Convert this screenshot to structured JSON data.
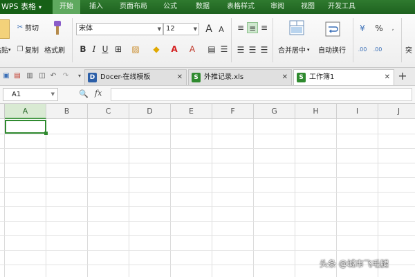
{
  "app": {
    "brand": "WPS 表格",
    "brand_caret": "▾"
  },
  "menu": {
    "items": [
      "开始",
      "插入",
      "页面布局",
      "公式",
      "数据",
      "表格样式",
      "审阅",
      "视图",
      "开发工具"
    ],
    "active_index": 0
  },
  "ribbon": {
    "paste_label": "粘贴",
    "cut_label": "剪切",
    "copy_label": "复制",
    "format_painter_label": "格式刷",
    "font_name": "宋体",
    "font_size": "12",
    "bold": "B",
    "italic": "I",
    "underline": "U",
    "grow_font": "A",
    "shrink_font": "A",
    "merge_center_label": "合并居中",
    "wrap_text_label": "自动换行",
    "percent": "%",
    "increase_decimal": ".00",
    "decrease_decimal": ".00",
    "right_cut_label": "突"
  },
  "tabs": [
    {
      "label": "Docer-在线模板",
      "icon": "D",
      "active": false
    },
    {
      "label": "外推记录.xls",
      "icon": "S",
      "active": false
    },
    {
      "label": "工作簿1",
      "icon": "S",
      "active": true
    }
  ],
  "formula_bar": {
    "name_box": "A1",
    "fx": "fx",
    "value": ""
  },
  "sheet": {
    "columns": [
      "A",
      "B",
      "C",
      "D",
      "E",
      "F",
      "G",
      "H",
      "I",
      "J"
    ],
    "selected_column": "A",
    "active_cell": "A1"
  },
  "watermark": "头条 @城市飞毛腿",
  "colors": {
    "menubar": "#1e621f",
    "accent": "#2f8a2f",
    "selected_header": "#d9ead3"
  }
}
